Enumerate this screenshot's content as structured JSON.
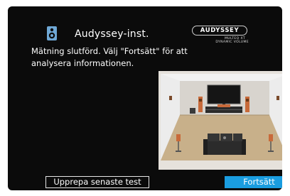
{
  "header": {
    "icon": "speaker-icon",
    "title": "Audyssey-inst."
  },
  "logo": {
    "brand": "AUDYSSEY",
    "line1": "MULTEQ XT",
    "line2": "DYNAMIC VOLUME"
  },
  "message": "Mätning slutförd. Välj \"Fortsätt\" för att analysera informationen.",
  "illustration": "room-setup-illustration",
  "buttons": {
    "repeat_label": "Upprepa senaste test",
    "continue_label": "Fortsätt"
  },
  "colors": {
    "background": "#0b0b0b",
    "accent": "#1a9de0",
    "text": "#ffffff"
  }
}
